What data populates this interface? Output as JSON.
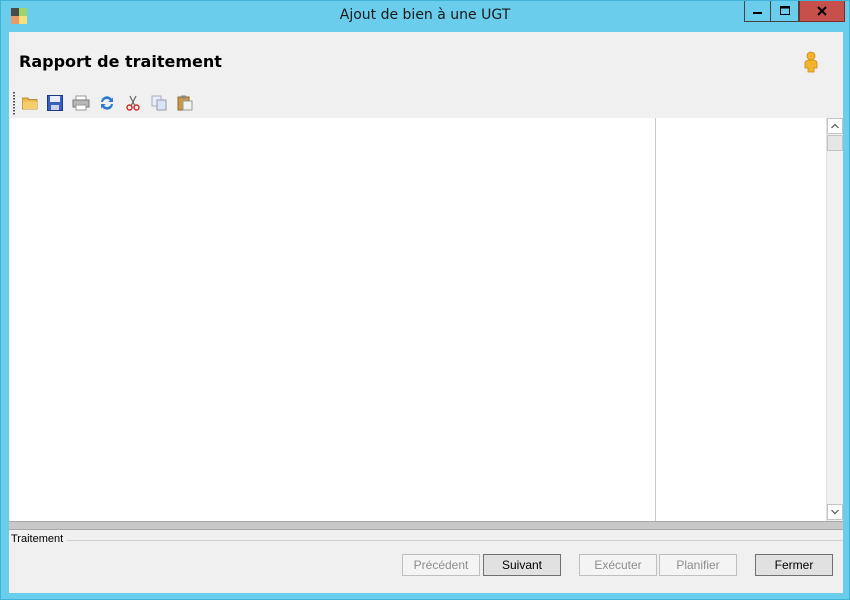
{
  "window": {
    "title": "Ajout de bien à une UGT",
    "controls": {
      "minimize": "minimize-icon",
      "maximize": "maximize-icon",
      "close": "close-icon"
    }
  },
  "page": {
    "heading": "Rapport de traitement"
  },
  "toolbar": {
    "items": [
      "open-folder-icon",
      "save-icon",
      "print-icon",
      "refresh-icon",
      "cut-icon",
      "copy-icon",
      "paste-icon"
    ]
  },
  "group": {
    "label": "Traitement"
  },
  "buttons": {
    "previous": "Précédent",
    "next": "Suivant",
    "execute": "Exécuter",
    "schedule": "Planifier",
    "close": "Fermer"
  },
  "colors": {
    "titlebar": "#69cdeb",
    "close": "#c7504a",
    "client": "#f0f0f0"
  }
}
